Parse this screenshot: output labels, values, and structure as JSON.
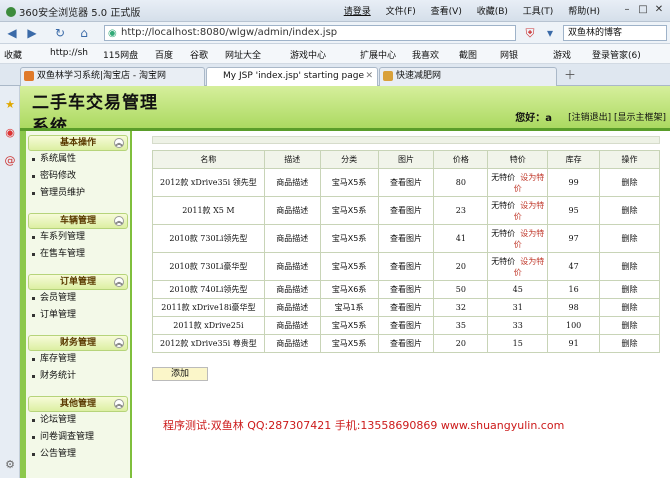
{
  "browser": {
    "title": "360安全浏览器 5.0 正式版",
    "login": "请登录",
    "menus": [
      "文件(F)",
      "查看(V)",
      "收藏(B)",
      "工具(T)",
      "帮助(H)"
    ],
    "address": "http://localhost:8080/wlgw/admin/index.jsp",
    "search_text": "双鱼林的博客",
    "favorites": [
      "收藏",
      "http://sh",
      "115网盘",
      "百度",
      "谷歌",
      "网址大全",
      "游戏中心",
      "扩展中心",
      "我喜欢",
      "截图",
      "网银",
      "游戏",
      "登录管家(6)"
    ],
    "tabs": [
      "双鱼林学习系统|淘宝店 - 淘宝网",
      "My JSP 'index.jsp' starting page",
      "快速减肥网"
    ]
  },
  "header": {
    "site_title": "二手车交易管理系统",
    "welcome": "您好：a",
    "logout": "[注销退出]",
    "show_main": "[显示主框架]"
  },
  "sidebar": [
    {
      "title": "基本操作",
      "items": [
        "系统属性",
        "密码修改",
        "管理员维护"
      ]
    },
    {
      "title": "车辆管理",
      "items": [
        "车系列管理",
        "在售车管理"
      ]
    },
    {
      "title": "订单管理",
      "items": [
        "会员管理",
        "订单管理"
      ]
    },
    {
      "title": "财务管理",
      "items": [
        "库存管理",
        "财务统计"
      ]
    },
    {
      "title": "其他管理",
      "items": [
        "论坛管理",
        "问卷调查管理",
        "公告管理"
      ]
    }
  ],
  "table": {
    "headers": [
      "名称",
      "描述",
      "分类",
      "图片",
      "价格",
      "特价",
      "库存",
      "操作"
    ],
    "rows": [
      {
        "name": "2012款 xDrive35i 领先型",
        "desc": "商品描述",
        "cat": "宝马X5系",
        "img": "查看图片",
        "price": "80",
        "spec": "无特价",
        "setspec": "设为特价",
        "stock": "99",
        "op": "删除"
      },
      {
        "name": "2011款 X5 M",
        "desc": "商品描述",
        "cat": "宝马X5系",
        "img": "查看图片",
        "price": "23",
        "spec": "无特价",
        "setspec": "设为特价",
        "stock": "95",
        "op": "删除"
      },
      {
        "name": "2010款 730Li领先型",
        "desc": "商品描述",
        "cat": "宝马X5系",
        "img": "查看图片",
        "price": "41",
        "spec": "无特价",
        "setspec": "设为特价",
        "stock": "97",
        "op": "删除"
      },
      {
        "name": "2010款 730Li豪华型",
        "desc": "商品描述",
        "cat": "宝马X5系",
        "img": "查看图片",
        "price": "20",
        "spec": "无特价",
        "setspec": "设为特价",
        "stock": "47",
        "op": "删除"
      },
      {
        "name": "2010款 740Li领先型",
        "desc": "商品描述",
        "cat": "宝马X6系",
        "img": "查看图片",
        "price": "50",
        "spec": "45",
        "setspec": "",
        "stock": "16",
        "op": "删除"
      },
      {
        "name": "2011款 xDrive18i豪华型",
        "desc": "商品描述",
        "cat": "宝马1系",
        "img": "查看图片",
        "price": "32",
        "spec": "31",
        "setspec": "",
        "stock": "98",
        "op": "删除"
      },
      {
        "name": "2011款 xDrive25i",
        "desc": "商品描述",
        "cat": "宝马X5系",
        "img": "查看图片",
        "price": "35",
        "spec": "33",
        "setspec": "",
        "stock": "100",
        "op": "删除"
      },
      {
        "name": "2012款 xDrive35i 尊贵型",
        "desc": "商品描述",
        "cat": "宝马X5系",
        "img": "查看图片",
        "price": "20",
        "spec": "15",
        "setspec": "",
        "stock": "91",
        "op": "删除"
      }
    ]
  },
  "add_button": "添加",
  "footer": "程序测试:双鱼林 QQ:287307421 手机:13558690869 www.shuangyulin.com"
}
